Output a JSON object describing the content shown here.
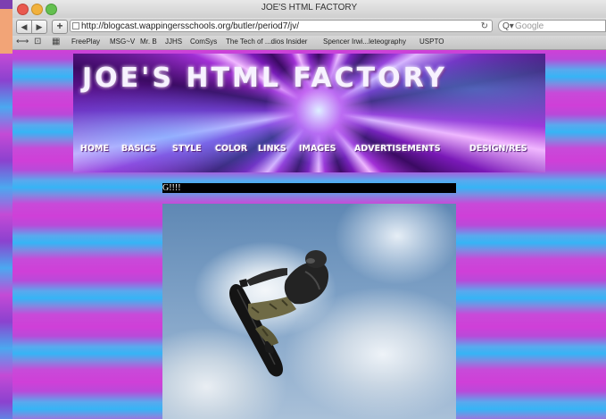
{
  "window": {
    "title": "JOE'S HTML FACTORY"
  },
  "toolbar": {
    "back_icon": "◀",
    "forward_icon": "▶",
    "add_icon": "+",
    "url": "http://blogcast.wappingersschools.org/butler/period7/jv/",
    "reload_icon": "↻",
    "search_placeholder": "Google"
  },
  "bookmarks": {
    "items": [
      "FreePlay",
      "MSG~V",
      "Mr. B",
      "JJHS",
      "ComSys",
      "The Tech of ...dios Insider",
      "Spencer Irwi...leteography",
      "USPTO"
    ]
  },
  "page": {
    "banner_title": "JOE'S HTML FACTORY",
    "nav": [
      "HOME",
      "BASICS",
      "STYLE",
      "COLOR",
      "LINKS",
      "IMAGES",
      "ADVERTISEMENTS",
      "DESIGN/RES"
    ],
    "heading_fragment": "G!!!!"
  },
  "colors": {
    "accent_purple": "#cf3fd8",
    "accent_blue": "#36b4f5"
  }
}
